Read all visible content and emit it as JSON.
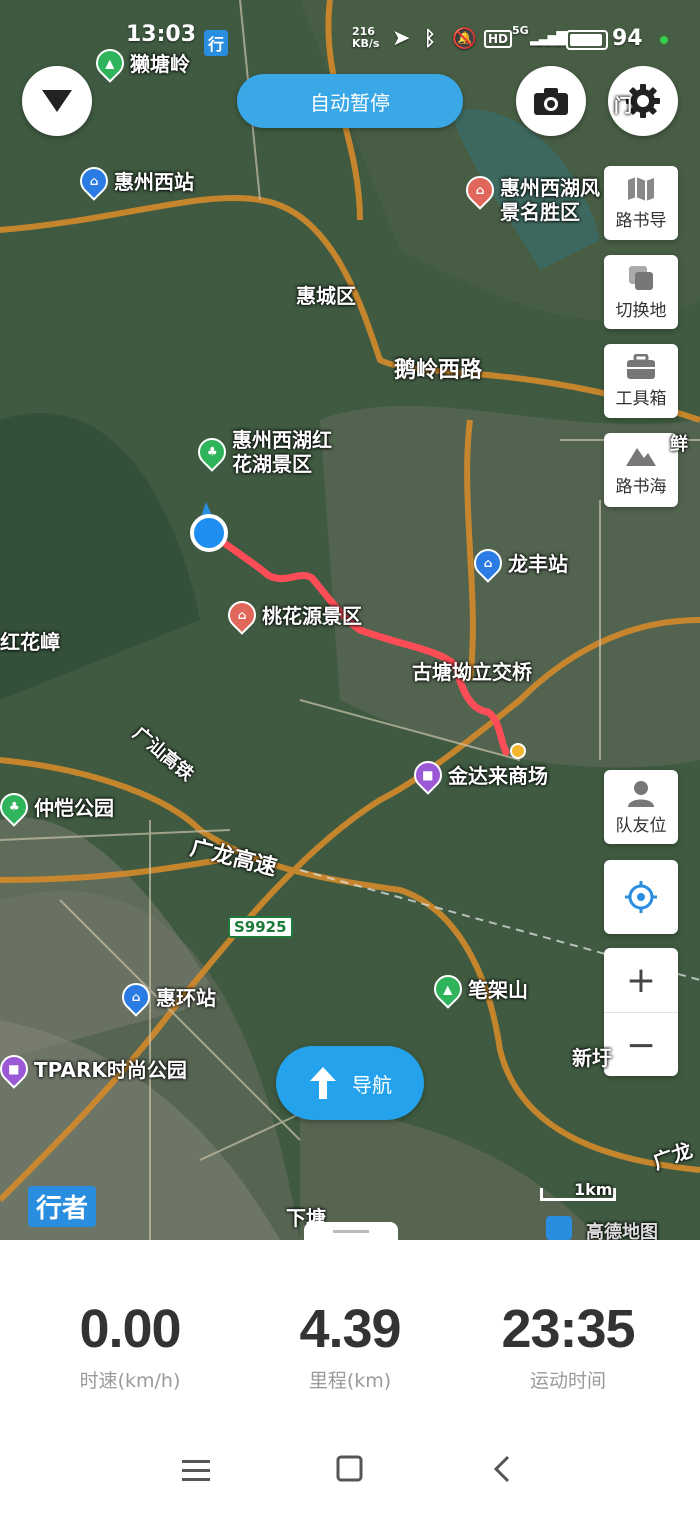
{
  "status_bar": {
    "time": "13:03",
    "app_indicator": "行",
    "net_speed": "216\nKB/s",
    "network": "5G",
    "battery": "94"
  },
  "top": {
    "auto_pause": "自动暂停"
  },
  "side_buttons": [
    {
      "label": "路书导",
      "icon": "map-icon"
    },
    {
      "label": "切换地",
      "icon": "layers-icon"
    },
    {
      "label": "工具箱",
      "icon": "toolbox-icon"
    },
    {
      "label": "路书海",
      "icon": "mountain-icon"
    }
  ],
  "teammate": {
    "label": "队友位"
  },
  "zoom": {
    "in": "+",
    "out": "−"
  },
  "map_labels": {
    "p1": "獭塘岭",
    "p2": "惠州西站",
    "p3": "惠州西湖风",
    "p3b": "景名胜区",
    "p4": "惠城区",
    "p5": "鹅岭西路",
    "p6": "惠州西湖红",
    "p6b": "花湖景区",
    "p7": "龙丰站",
    "p8": "桃花源景区",
    "p9": "红花嶂",
    "p10": "古塘坳立交桥",
    "p11": "金达来商场",
    "p12": "广汕高铁",
    "p13": "仲恺公园",
    "p14": "广龙高速",
    "p15": "S9925",
    "p16": "笔架山",
    "p17": "惠环站",
    "p18": "TPARK时尚公园",
    "p19": "新圩",
    "p20": "下塘",
    "p21": "广龙",
    "p22": "1km",
    "p23": "高德地图",
    "p24": "鲜",
    "p25": "门"
  },
  "navigate": {
    "label": "导航"
  },
  "mode_badge": "行者",
  "stats": [
    {
      "value": "0.00",
      "unit": "时速(km/h)"
    },
    {
      "value": "4.39",
      "unit": "里程(km)"
    },
    {
      "value": "23:35",
      "unit": "运动时间"
    }
  ],
  "colors": {
    "route": "#ff4d57",
    "accent": "#24a3ec"
  }
}
